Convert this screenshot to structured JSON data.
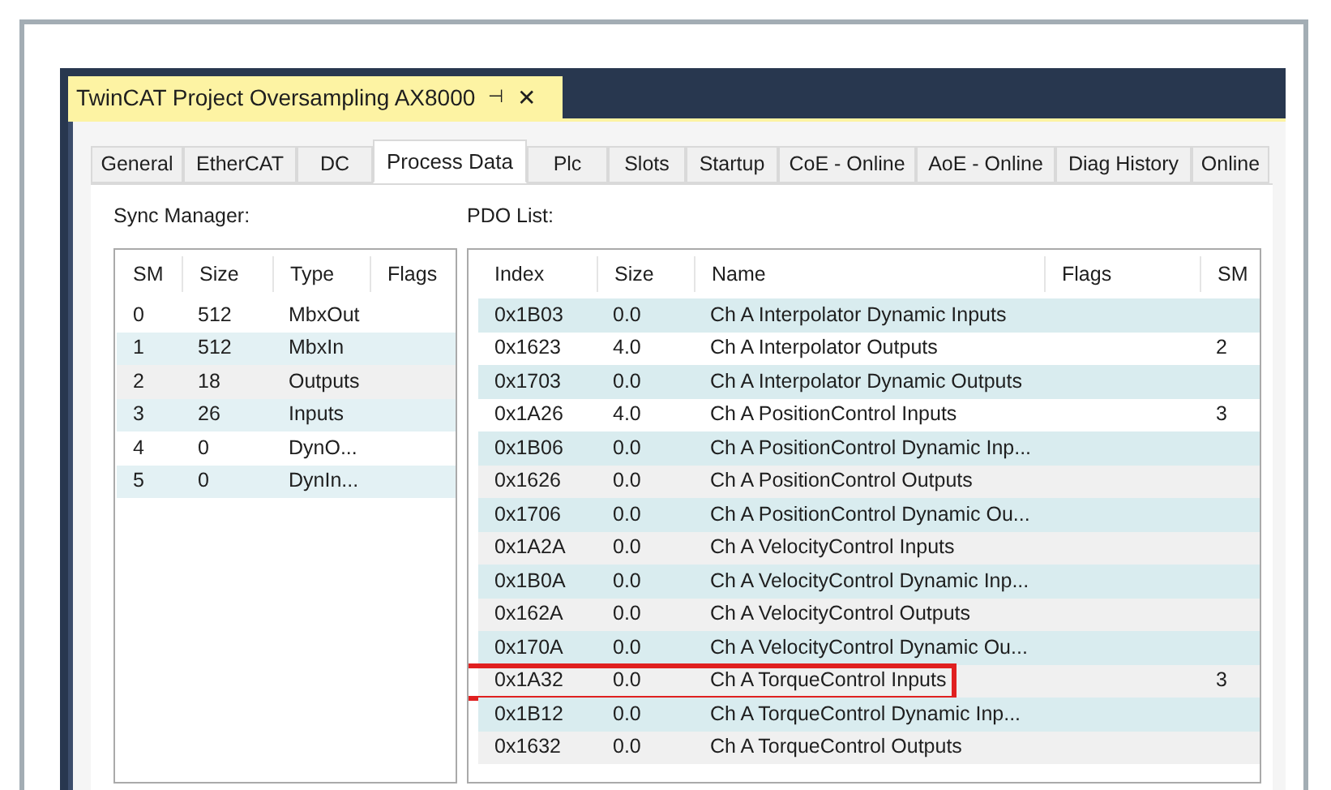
{
  "document_tab": {
    "title": "TwinCAT Project Oversampling AX8000",
    "pin": "⊣",
    "close": "✕"
  },
  "tabs": [
    {
      "label": "General",
      "selected": false
    },
    {
      "label": "EtherCAT",
      "selected": false
    },
    {
      "label": "DC",
      "selected": false
    },
    {
      "label": "Process Data",
      "selected": true
    },
    {
      "label": "Plc",
      "selected": false
    },
    {
      "label": "Slots",
      "selected": false
    },
    {
      "label": "Startup",
      "selected": false
    },
    {
      "label": "CoE - Online",
      "selected": false
    },
    {
      "label": "AoE - Online",
      "selected": false
    },
    {
      "label": "Diag History",
      "selected": false
    },
    {
      "label": "Online",
      "selected": false
    }
  ],
  "sync_manager": {
    "label": "Sync Manager:",
    "columns": [
      "SM",
      "Size",
      "Type",
      "Flags"
    ],
    "rows": [
      {
        "cells": [
          "0",
          "512",
          "MbxOut",
          ""
        ],
        "color": "#ffffff"
      },
      {
        "cells": [
          "1",
          "512",
          "MbxIn",
          ""
        ],
        "color": "#e3f1f4"
      },
      {
        "cells": [
          "2",
          "18",
          "Outputs",
          ""
        ],
        "color": "#f0f0f0"
      },
      {
        "cells": [
          "3",
          "26",
          "Inputs",
          ""
        ],
        "color": "#e3f1f4"
      },
      {
        "cells": [
          "4",
          "0",
          "DynO...",
          ""
        ],
        "color": "#ffffff"
      },
      {
        "cells": [
          "5",
          "0",
          "DynIn...",
          ""
        ],
        "color": "#e3f1f4"
      }
    ]
  },
  "pdo_list": {
    "label": "PDO List:",
    "columns": [
      "Index",
      "Size",
      "Name",
      "Flags",
      "SM"
    ],
    "rows": [
      {
        "cells": [
          "0x1B03",
          "0.0",
          "Ch A Interpolator Dynamic Inputs",
          "",
          ""
        ],
        "color": "#d9ecef",
        "highlighted": false
      },
      {
        "cells": [
          "0x1623",
          "4.0",
          "Ch A Interpolator Outputs",
          "",
          "2"
        ],
        "color": "#ffffff",
        "highlighted": false
      },
      {
        "cells": [
          "0x1703",
          "0.0",
          "Ch A Interpolator Dynamic Outputs",
          "",
          ""
        ],
        "color": "#d9ecef",
        "highlighted": false
      },
      {
        "cells": [
          "0x1A26",
          "4.0",
          "Ch A PositionControl Inputs",
          "",
          "3"
        ],
        "color": "#ffffff",
        "highlighted": false
      },
      {
        "cells": [
          "0x1B06",
          "0.0",
          "Ch A PositionControl Dynamic Inp...",
          "",
          ""
        ],
        "color": "#d9ecef",
        "highlighted": false
      },
      {
        "cells": [
          "0x1626",
          "0.0",
          "Ch A PositionControl Outputs",
          "",
          ""
        ],
        "color": "#f0f0f0",
        "highlighted": false
      },
      {
        "cells": [
          "0x1706",
          "0.0",
          "Ch A PositionControl Dynamic Ou...",
          "",
          ""
        ],
        "color": "#d9ecef",
        "highlighted": false
      },
      {
        "cells": [
          "0x1A2A",
          "0.0",
          "Ch A VelocityControl Inputs",
          "",
          ""
        ],
        "color": "#f0f0f0",
        "highlighted": false
      },
      {
        "cells": [
          "0x1B0A",
          "0.0",
          "Ch A VelocityControl Dynamic Inp...",
          "",
          ""
        ],
        "color": "#d9ecef",
        "highlighted": false
      },
      {
        "cells": [
          "0x162A",
          "0.0",
          "Ch A VelocityControl Outputs",
          "",
          ""
        ],
        "color": "#f0f0f0",
        "highlighted": false
      },
      {
        "cells": [
          "0x170A",
          "0.0",
          "Ch A VelocityControl Dynamic Ou...",
          "",
          ""
        ],
        "color": "#d9ecef",
        "highlighted": false
      },
      {
        "cells": [
          "0x1A32",
          "0.0",
          "Ch A TorqueControl Inputs",
          "",
          "3"
        ],
        "color": "#f0f0f0",
        "highlighted": true
      },
      {
        "cells": [
          "0x1B12",
          "0.0",
          "Ch A TorqueControl Dynamic Inp...",
          "",
          ""
        ],
        "color": "#d9ecef",
        "highlighted": false
      },
      {
        "cells": [
          "0x1632",
          "0.0",
          "Ch A TorqueControl Outputs",
          "",
          ""
        ],
        "color": "#f0f0f0",
        "highlighted": false
      }
    ]
  }
}
